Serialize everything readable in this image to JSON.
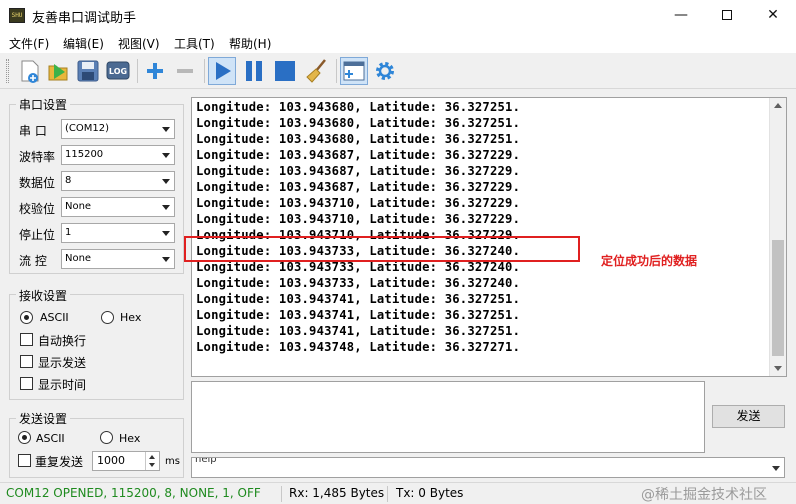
{
  "window": {
    "title": "友善串口调试助手",
    "icon_text": "SHU"
  },
  "menu": [
    "文件(F)",
    "编辑(E)",
    "视图(V)",
    "工具(T)",
    "帮助(H)"
  ],
  "toolbar_icons": [
    "new-file-icon",
    "open-folder-icon",
    "save-icon",
    "log-icon",
    "add-icon",
    "remove-icon",
    "play-icon",
    "pause-icon",
    "stop-icon",
    "broom-icon",
    "window-layout-icon",
    "gear-icon"
  ],
  "serial_settings": {
    "title": "串口设置",
    "rows": [
      {
        "label": "串  口",
        "value": "(COM12)"
      },
      {
        "label": "波特率",
        "value": "115200"
      },
      {
        "label": "数据位",
        "value": "8"
      },
      {
        "label": "校验位",
        "value": "None"
      },
      {
        "label": "停止位",
        "value": "1"
      },
      {
        "label": "流  控",
        "value": "None"
      }
    ]
  },
  "receive_settings": {
    "title": "接收设置",
    "mode_ascii": "ASCII",
    "mode_hex": "Hex",
    "selected_mode": "ASCII",
    "options": [
      {
        "label": "自动换行",
        "checked": false
      },
      {
        "label": "显示发送",
        "checked": false
      },
      {
        "label": "显示时间",
        "checked": false
      }
    ]
  },
  "send_settings": {
    "title": "发送设置",
    "mode_ascii": "ASCII",
    "mode_hex": "Hex",
    "selected_mode": "ASCII",
    "repeat_label": "重复发送",
    "repeat_checked": false,
    "interval": "1000",
    "unit": "ms"
  },
  "receive_lines": [
    "Longitude: 103.943680, Latitude: 36.327251.",
    "Longitude: 103.943680, Latitude: 36.327251.",
    "Longitude: 103.943680, Latitude: 36.327251.",
    "Longitude: 103.943687, Latitude: 36.327229.",
    "Longitude: 103.943687, Latitude: 36.327229.",
    "Longitude: 103.943687, Latitude: 36.327229.",
    "Longitude: 103.943710, Latitude: 36.327229.",
    "Longitude: 103.943710, Latitude: 36.327229.",
    "Longitude: 103.943710, Latitude: 36.327229.",
    "Longitude: 103.943733, Latitude: 36.327240.",
    "Longitude: 103.943733, Latitude: 36.327240.",
    "Longitude: 103.943733, Latitude: 36.327240.",
    "Longitude: 103.943741, Latitude: 36.327251.",
    "Longitude: 103.943741, Latitude: 36.327251.",
    "Longitude: 103.943741, Latitude: 36.327251.",
    "Longitude: 103.943748, Latitude: 36.327271."
  ],
  "annotation": "定位成功后的数据",
  "annotation_color": "#e02020",
  "send_button": "发送",
  "help_text": "help",
  "status": {
    "port": "COM12 OPENED, 115200, 8, NONE, 1, OFF",
    "rx": "Rx: 1,485 Bytes",
    "tx": "Tx: 0 Bytes"
  },
  "watermark": "@稀土掘金技术社区"
}
